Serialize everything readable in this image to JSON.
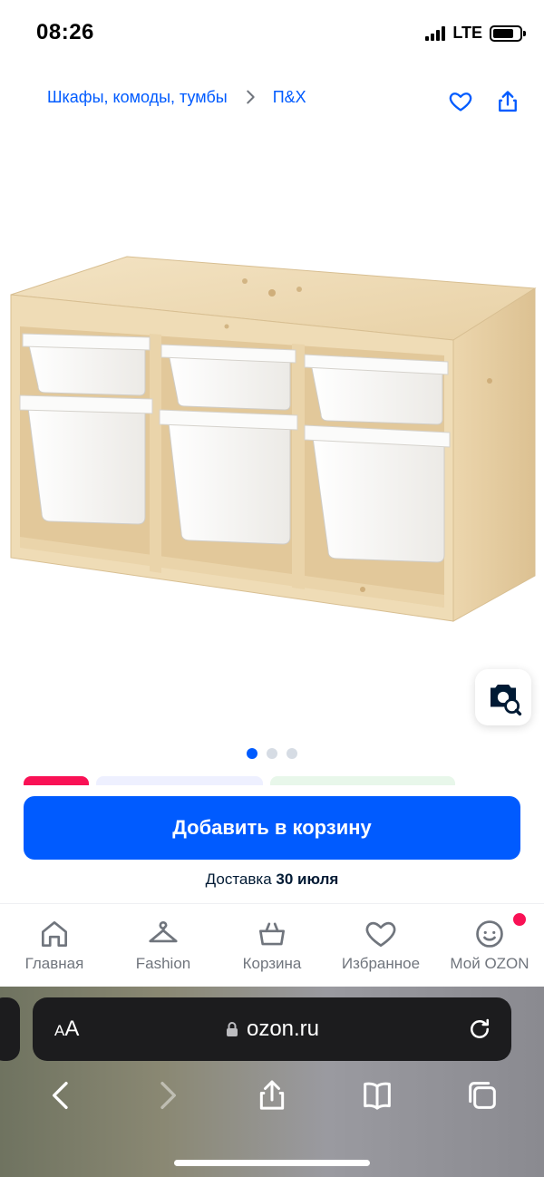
{
  "status_bar": {
    "time": "08:26",
    "network": "LTE"
  },
  "breadcrumb": {
    "category": "Шкафы, комоды, тумбы",
    "brand": "П&Х"
  },
  "product": {
    "image_alt": "",
    "gallery_total": 3,
    "gallery_active": 1
  },
  "cart": {
    "add_label": "Добавить в корзину",
    "delivery_prefix": "Доставка",
    "delivery_date": "30 июля"
  },
  "bottom_nav": {
    "items": [
      {
        "label": "Главная",
        "icon": "home-icon"
      },
      {
        "label": "Fashion",
        "icon": "hanger-icon"
      },
      {
        "label": "Корзина",
        "icon": "basket-icon"
      },
      {
        "label": "Избранное",
        "icon": "heart-icon"
      },
      {
        "label": "Мой OZON",
        "icon": "profile-face-icon"
      }
    ]
  },
  "browser": {
    "text_size_label": "AA",
    "url": "ozon.ru"
  },
  "colors": {
    "accent": "#005bff",
    "badge": "#f91155",
    "chip_sale": "#f91155"
  }
}
